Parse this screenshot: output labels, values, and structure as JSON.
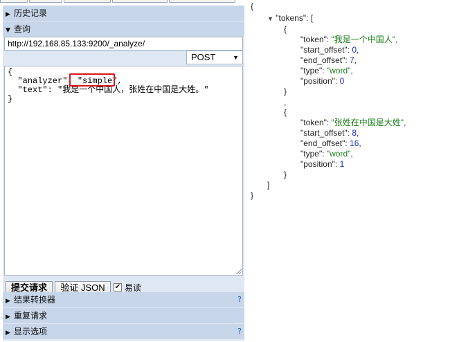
{
  "left_panel": {
    "sections": {
      "history": {
        "label": "历史记录"
      },
      "query": {
        "label": "查询"
      },
      "transformer": {
        "label": "结果转换器",
        "help": "?"
      },
      "repeat": {
        "label": "重复请求"
      },
      "display": {
        "label": "显示选项",
        "help": "?"
      }
    },
    "url_value": "http://192.168.85.133:9200/_analyze/",
    "method": {
      "selected": "POST"
    },
    "body": {
      "line1": "{",
      "line2": "  \"analyzer\": \"simple\",",
      "line3": "  \"text\": \"我是一个中国人，张姓在中国是大姓。\"",
      "line4": "}"
    },
    "actions": {
      "submit_label": "提交请求",
      "validate_label": "验证 JSON",
      "pretty_label": "易读",
      "pretty_checked": true
    }
  },
  "response": {
    "open_brace": "{",
    "tokens_key": "\"tokens\"",
    "open_bracket": "[",
    "items": [
      {
        "token": "\"我是一个中国人\"",
        "start_offset": "0",
        "end_offset": "7",
        "type": "\"word\"",
        "position": "0"
      },
      {
        "token": "\"张姓在中国是大姓\"",
        "start_offset": "8",
        "end_offset": "16",
        "type": "\"word\"",
        "position": "1"
      }
    ],
    "labels": {
      "token": "\"token\"",
      "start_offset": "\"start_offset\"",
      "end_offset": "\"end_offset\"",
      "type": "\"type\"",
      "position": "\"position\""
    },
    "close_bracket": "]",
    "close_brace": "}"
  }
}
